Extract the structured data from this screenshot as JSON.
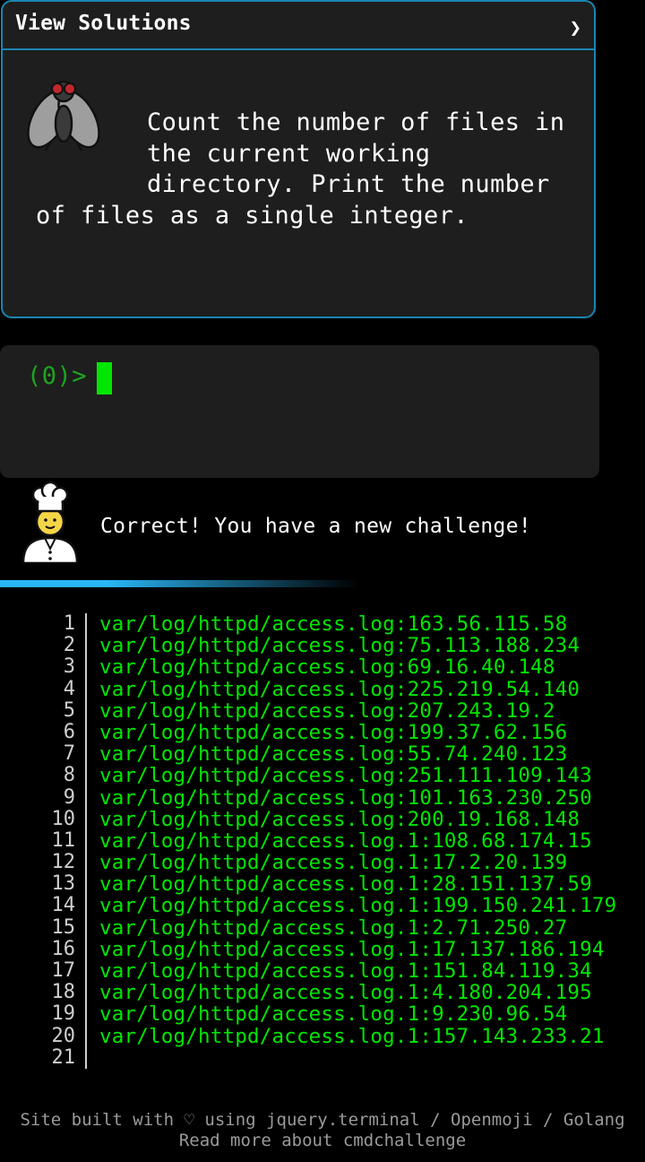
{
  "panel": {
    "header_label": "View Solutions",
    "chevron_glyph": "❯",
    "task": "Count the number of files in the current working directory. Print the number of files as a single integer.",
    "icon": "fly-icon"
  },
  "terminal": {
    "prompt_count": "(0)",
    "prompt_symbol": ">"
  },
  "chef": {
    "icon": "chef-icon",
    "message": "Correct! You have a new challenge!"
  },
  "output": {
    "lines": [
      {
        "n": "1",
        "text": "var/log/httpd/access.log:163.56.115.58"
      },
      {
        "n": "2",
        "text": "var/log/httpd/access.log:75.113.188.234"
      },
      {
        "n": "3",
        "text": "var/log/httpd/access.log:69.16.40.148"
      },
      {
        "n": "4",
        "text": "var/log/httpd/access.log:225.219.54.140"
      },
      {
        "n": "5",
        "text": "var/log/httpd/access.log:207.243.19.2"
      },
      {
        "n": "6",
        "text": "var/log/httpd/access.log:199.37.62.156"
      },
      {
        "n": "7",
        "text": "var/log/httpd/access.log:55.74.240.123"
      },
      {
        "n": "8",
        "text": "var/log/httpd/access.log:251.111.109.143"
      },
      {
        "n": "9",
        "text": "var/log/httpd/access.log:101.163.230.250"
      },
      {
        "n": "10",
        "text": "var/log/httpd/access.log:200.19.168.148"
      },
      {
        "n": "11",
        "text": "var/log/httpd/access.log.1:108.68.174.15"
      },
      {
        "n": "12",
        "text": "var/log/httpd/access.log.1:17.2.20.139"
      },
      {
        "n": "13",
        "text": "var/log/httpd/access.log.1:28.151.137.59"
      },
      {
        "n": "14",
        "text": "var/log/httpd/access.log.1:199.150.241.179"
      },
      {
        "n": "15",
        "text": "var/log/httpd/access.log.1:2.71.250.27"
      },
      {
        "n": "16",
        "text": "var/log/httpd/access.log.1:17.137.186.194"
      },
      {
        "n": "17",
        "text": "var/log/httpd/access.log.1:151.84.119.34"
      },
      {
        "n": "18",
        "text": "var/log/httpd/access.log.1:4.180.204.195"
      },
      {
        "n": "19",
        "text": "var/log/httpd/access.log.1:9.230.96.54"
      },
      {
        "n": "20",
        "text": "var/log/httpd/access.log.1:157.143.233.21"
      },
      {
        "n": "21",
        "text": ""
      }
    ]
  },
  "footer": {
    "line1_prefix": "Site built with",
    "heart": "♡",
    "line1_using": "using",
    "link_terminal": "jquery.terminal",
    "sep1": "/",
    "link_openmoji": "Openmoji",
    "sep2": "/",
    "link_golang": "Golang",
    "read_more": "Read more about cmdchallenge"
  },
  "colors": {
    "panel_border": "#1a86b3",
    "panel_bg": "#1e1e1e",
    "terminal_green": "#00e600",
    "prompt_green": "#1fa41f",
    "accent_bar": "#29b6f6"
  }
}
